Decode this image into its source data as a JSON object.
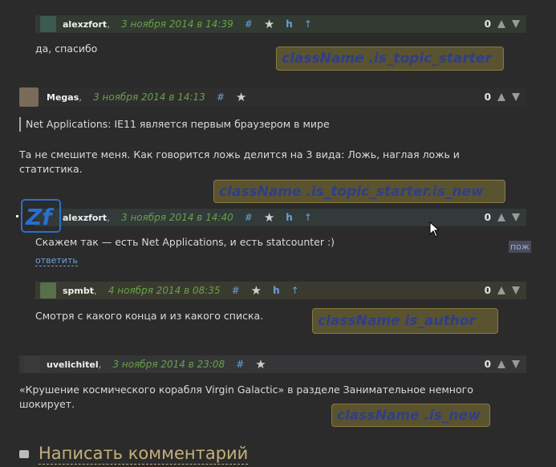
{
  "comments": [
    {
      "id": "c1",
      "user": "alexzfort",
      "date": "3 ноября 2014 в 14:39",
      "hash": "#",
      "h": "h",
      "up": "↑",
      "score": "0",
      "text": "да, спасибо"
    },
    {
      "id": "c2",
      "user": "Megas",
      "date": "3 ноября 2014 в 14:13",
      "hash": "#",
      "score": "0",
      "quote": "Net Applications: IE11 является первым браузером в мире",
      "text": "Та не смешите меня. Как говорится ложь делится на 3 вида: Ложь, наглая ложь и статистика."
    },
    {
      "id": "c3",
      "user": "alexzfort",
      "date": "3 ноября 2014 в 14:40",
      "hash": "#",
      "h": "h",
      "up": "↑",
      "score": "0",
      "text": "Скажем так — есть Net Applications, и есть statcounter :)",
      "reply": "ответить",
      "poz": "пож"
    },
    {
      "id": "c4",
      "user": "spmbt",
      "date": "4 ноября 2014 в 08:35",
      "hash": "#",
      "h": "h",
      "up": "↑",
      "score": "0",
      "text": "Смотря с какого конца и из какого списка."
    },
    {
      "id": "c5",
      "user": "uvelichitel",
      "date": "3 ноября 2014 в 23:08",
      "hash": "#",
      "score": "0",
      "text": "«Крушение космического корабля Virgin Galactic» в разделе Занимательное немного шокирует."
    }
  ],
  "labels": {
    "topic_starter": "className .is_topic_starter",
    "topic_starter_new": "className  .is_topic_starter.is_new",
    "author": "className  is_author",
    "is_new": "className .is_new"
  },
  "write_comment": "Написать комментарий",
  "colors": {
    "background": "#2b2b2b",
    "date": "#67a147",
    "link": "#6aa0d8",
    "label_bg": "#5a5330",
    "label_text": "#2f3e8a"
  }
}
